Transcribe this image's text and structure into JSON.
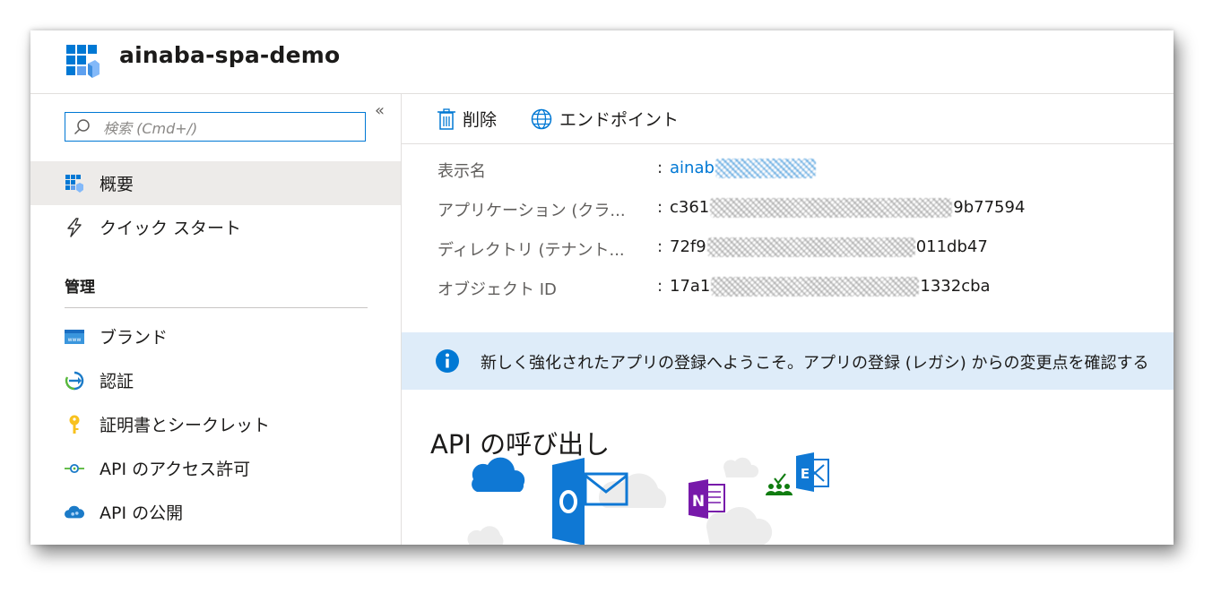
{
  "header": {
    "title": "ainaba-spa-demo",
    "icon": "app-registration-grid-icon"
  },
  "sidebar": {
    "search_placeholder": "検索 (Cmd+/)",
    "collapse_label": "«",
    "items_top": [
      {
        "label": "概要",
        "icon": "overview-grid-icon",
        "active": true
      },
      {
        "label": "クイック スタート",
        "icon": "lightning-icon",
        "active": false
      }
    ],
    "section_title": "管理",
    "items_manage": [
      {
        "label": "ブランド",
        "icon": "branding-www-icon"
      },
      {
        "label": "認証",
        "icon": "authentication-arrow-icon"
      },
      {
        "label": "証明書とシークレット",
        "icon": "key-icon"
      },
      {
        "label": "API のアクセス許可",
        "icon": "api-permissions-icon"
      },
      {
        "label": "API の公開",
        "icon": "cloud-expose-icon"
      }
    ]
  },
  "toolbar": {
    "delete_label": "削除",
    "endpoints_label": "エンドポイント"
  },
  "properties": [
    {
      "key": "表示名",
      "sep": ":",
      "value_prefix": "ainab",
      "value_suffix": "",
      "link": true
    },
    {
      "key": "アプリケーション (クラ...",
      "sep": ":",
      "value_prefix": "c361",
      "value_suffix": "9b77594",
      "link": false
    },
    {
      "key": "ディレクトリ (テナント...",
      "sep": ":",
      "value_prefix": "72f9",
      "value_suffix": "011db47",
      "link": false
    },
    {
      "key": "オブジェクト ID",
      "sep": ":",
      "value_prefix": "17a1",
      "value_suffix": "1332cba",
      "link": false
    }
  ],
  "info_bar": {
    "text": "新しく強化されたアプリの登録へようこそ。アプリの登録 (レガシ) からの変更点を確認する"
  },
  "api_section": {
    "title": "API の呼び出し",
    "service_icons": [
      "onedrive-cloud-icon",
      "outlook-icon",
      "onenote-icon",
      "people-check-icon",
      "exchange-icon"
    ]
  },
  "colors": {
    "accent": "#0078d4",
    "info_bg": "#deecf9",
    "active_bg": "#edebe9"
  }
}
